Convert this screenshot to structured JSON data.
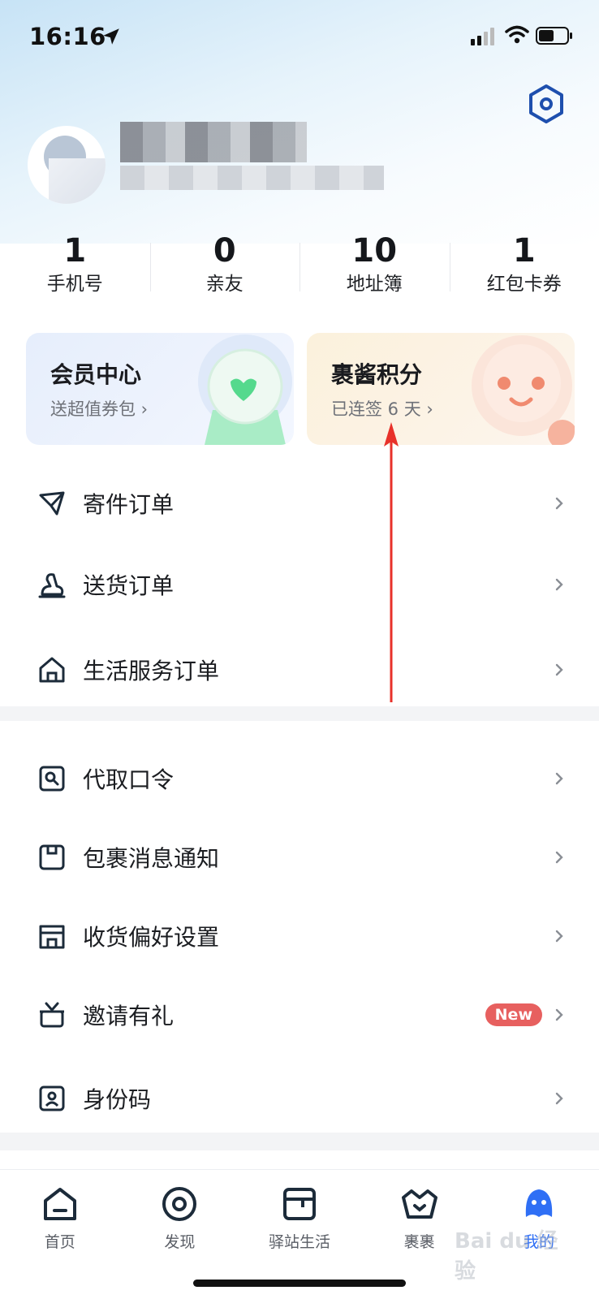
{
  "status_bar": {
    "time": "16:16"
  },
  "stats": [
    {
      "value": "1",
      "label": "手机号"
    },
    {
      "value": "0",
      "label": "亲友"
    },
    {
      "value": "10",
      "label": "地址簿"
    },
    {
      "value": "1",
      "label": "红包卡券"
    }
  ],
  "cards": {
    "member": {
      "title": "会员中心",
      "subtitle": "送超值券包 ›"
    },
    "points": {
      "title": "裹酱积分",
      "subtitle": "已连签 6 天 ›"
    }
  },
  "menu_group_1": [
    {
      "label": "寄件订单",
      "icon": "send-icon"
    },
    {
      "label": "送货订单",
      "icon": "delivery-icon"
    },
    {
      "label": "生活服务订单",
      "icon": "home-icon"
    }
  ],
  "menu_group_2": [
    {
      "label": "代取口令",
      "icon": "pickup-code-icon"
    },
    {
      "label": "包裹消息通知",
      "icon": "notification-icon"
    },
    {
      "label": "收货偏好设置",
      "icon": "store-icon"
    },
    {
      "label": "邀请有礼",
      "icon": "gift-icon",
      "badge": "New"
    },
    {
      "label": "身份码",
      "icon": "id-code-icon"
    }
  ],
  "tabs": [
    {
      "label": "首页",
      "icon": "home-tab-icon"
    },
    {
      "label": "发现",
      "icon": "discover-icon"
    },
    {
      "label": "驿站生活",
      "icon": "station-icon"
    },
    {
      "label": "裹裹",
      "icon": "guoguo-icon"
    },
    {
      "label": "我的",
      "icon": "profile-icon",
      "active": true
    }
  ],
  "watermark": "Bai du 经验",
  "colors": {
    "accent": "#2f6ff5",
    "badge": "#e7605f",
    "annotation": "#e8312a"
  }
}
